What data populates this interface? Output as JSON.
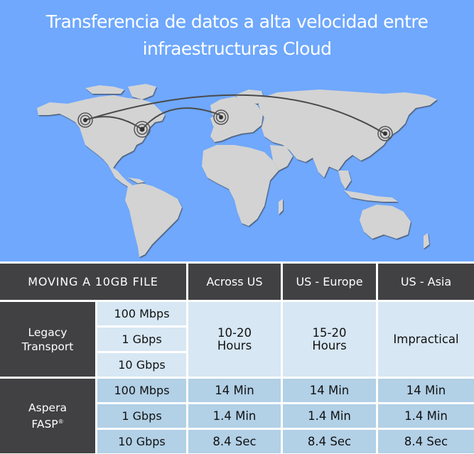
{
  "banner": {
    "title_line1": "Transferencia de datos a alta velocidad entre",
    "title_line2": "infraestructuras Cloud",
    "background_color": "#6fa8fd"
  },
  "map": {
    "markers": [
      "west-coast-us",
      "east-coast-us",
      "europe",
      "asia"
    ],
    "routes": [
      "west-us to east-us",
      "east-us to europe",
      "west-us to asia"
    ]
  },
  "table": {
    "header": {
      "corner": "MOVING A 10GB FILE",
      "columns": [
        "Across US",
        "US - Europe",
        "US - Asia"
      ]
    },
    "groups": [
      {
        "name_line1": "Legacy",
        "name_line2": "Transport",
        "speeds": [
          "100 Mbps",
          "1 Gbps",
          "10 Gbps"
        ],
        "merged_values": [
          {
            "line1": "10-20",
            "line2": "Hours"
          },
          {
            "line1": "15-20",
            "line2": "Hours"
          },
          {
            "line1": "Impractical",
            "line2": ""
          }
        ]
      },
      {
        "name_line1": "Aspera",
        "name_line2": "FASP",
        "name_mark": "®",
        "speeds": [
          "100 Mbps",
          "1 Gbps",
          "10 Gbps"
        ],
        "rows": [
          [
            "14 Min",
            "14 Min",
            "14 Min"
          ],
          [
            "1.4 Min",
            "1.4 Min",
            "1.4 Min"
          ],
          [
            "8.4 Sec",
            "8.4 Sec",
            "8.4 Sec"
          ]
        ]
      }
    ],
    "colors": {
      "header_bg": "#414042",
      "legacy_bg": "#d7e7f3",
      "fasp_bg": "#b2d0e6"
    }
  }
}
